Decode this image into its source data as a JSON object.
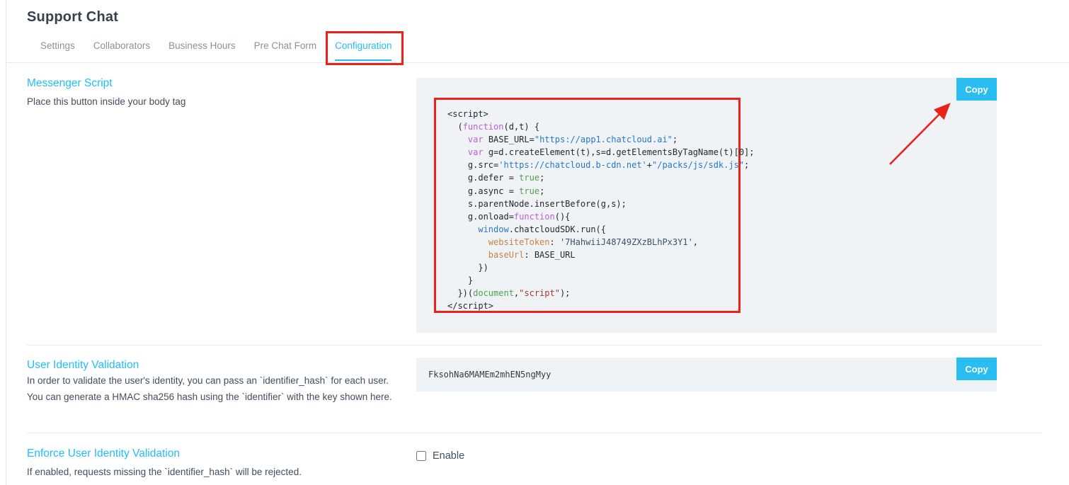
{
  "page": {
    "title": "Support Chat"
  },
  "tabs": [
    {
      "label": "Settings",
      "active": false
    },
    {
      "label": "Collaborators",
      "active": false
    },
    {
      "label": "Business Hours",
      "active": false
    },
    {
      "label": "Pre Chat Form",
      "active": false
    },
    {
      "label": "Configuration",
      "active": true
    }
  ],
  "sections": {
    "messenger_script": {
      "heading": "Messenger Script",
      "description": "Place this button inside your body tag",
      "copy_label": "Copy"
    },
    "user_identity": {
      "heading": "User Identity Validation",
      "description": "In order to validate the user's identity, you can pass an `identifier_hash` for each user. You can generate a HMAC sha256 hash using the `identifier` with the key shown here.",
      "hash": "FksohNa6MAMEm2mhEN5ngMyy",
      "copy_label": "Copy"
    },
    "enforce": {
      "heading": "Enforce User Identity Validation",
      "description": "If enabled, requests missing the `identifier_hash` will be rejected.",
      "checkbox_label": "Enable",
      "checkbox_checked": false
    }
  },
  "code": {
    "lines": [
      [
        [
          "plain",
          "<script>"
        ]
      ],
      [
        [
          "plain",
          "  ("
        ],
        [
          "kw",
          "function"
        ],
        [
          "plain",
          "(d,t) {"
        ]
      ],
      [
        [
          "plain",
          "    "
        ],
        [
          "kw",
          "var"
        ],
        [
          "plain",
          " BASE_URL="
        ],
        [
          "str",
          "\"https://app1.chatcloud.ai\""
        ],
        [
          "plain",
          ";"
        ]
      ],
      [
        [
          "plain",
          "    "
        ],
        [
          "kw",
          "var"
        ],
        [
          "plain",
          " g=d.createElement(t),s=d.getElementsByTagName(t)[0];"
        ]
      ],
      [
        [
          "plain",
          "    g.src="
        ],
        [
          "str",
          "'https://chatcloud.b-cdn.net'"
        ],
        [
          "plain",
          "+"
        ],
        [
          "str",
          "\"/packs/js/sdk.js\""
        ],
        [
          "plain",
          ";"
        ]
      ],
      [
        [
          "plain",
          "    g.defer = "
        ],
        [
          "bool",
          "true"
        ],
        [
          "plain",
          ";"
        ]
      ],
      [
        [
          "plain",
          "    g.async = "
        ],
        [
          "bool",
          "true"
        ],
        [
          "plain",
          ";"
        ]
      ],
      [
        [
          "plain",
          "    s.parentNode.insertBefore(g,s);"
        ]
      ],
      [
        [
          "plain",
          "    g.onload="
        ],
        [
          "kw",
          "function"
        ],
        [
          "plain",
          "(){"
        ]
      ],
      [
        [
          "plain",
          "      "
        ],
        [
          "blue",
          "window"
        ],
        [
          "plain",
          ".chatcloudSDK.run({"
        ]
      ],
      [
        [
          "plain",
          "        "
        ],
        [
          "prop",
          "websiteToken"
        ],
        [
          "plain",
          ": "
        ],
        [
          "navy",
          "'7HahwiiJ48749ZXzBLhPx3Y1'"
        ],
        [
          "plain",
          ","
        ]
      ],
      [
        [
          "plain",
          "        "
        ],
        [
          "prop",
          "baseUrl"
        ],
        [
          "plain",
          ": BASE_URL"
        ]
      ],
      [
        [
          "plain",
          "      })"
        ]
      ],
      [
        [
          "plain",
          "    }"
        ]
      ],
      [
        [
          "plain",
          "  })("
        ],
        [
          "green",
          "document"
        ],
        [
          "plain",
          ","
        ],
        [
          "red",
          "\"script\""
        ],
        [
          "plain",
          ");"
        ]
      ],
      [
        [
          "plain",
          "</script>"
        ]
      ]
    ]
  },
  "colors": {
    "accent": "#20bef8",
    "annotation": "#e8231d",
    "button": "#29bdf2",
    "panel": "#eff3f6"
  }
}
